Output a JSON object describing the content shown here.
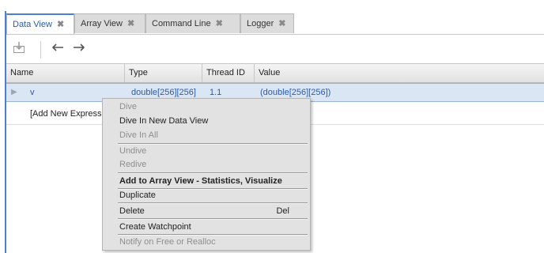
{
  "tabs": [
    {
      "label": "Data View",
      "active": true
    },
    {
      "label": "Array View",
      "active": false
    },
    {
      "label": "Command Line",
      "active": false
    },
    {
      "label": "Logger",
      "active": false
    }
  ],
  "tab_close_glyph": "✖",
  "toolbar": {
    "icons": [
      "dive-icon",
      "back-arrow-icon",
      "forward-arrow-icon"
    ]
  },
  "table": {
    "columns": [
      "Name",
      "Type",
      "Thread ID",
      "Value"
    ],
    "rows": [
      {
        "name": "v",
        "type": "double[256][256]",
        "thread": "1.1",
        "value": "(double[256][256])"
      }
    ],
    "add_new": "[Add New Expression]"
  },
  "context_menu": {
    "items": [
      {
        "label": "Dive",
        "disabled": true
      },
      {
        "label": "Dive In New Data View",
        "disabled": false
      },
      {
        "label": "Dive In All",
        "disabled": true
      },
      {
        "label": "Undive",
        "disabled": true
      },
      {
        "label": "Redive",
        "disabled": true
      },
      {
        "label": "Add to Array View - Statistics, Visualize",
        "disabled": false,
        "bold": true
      },
      {
        "label": "Duplicate",
        "disabled": false
      },
      {
        "label": "Delete",
        "disabled": false,
        "shortcut": "Del"
      },
      {
        "label": "Create Watchpoint",
        "disabled": false
      },
      {
        "label": "Notify on Free or Realloc",
        "disabled": true
      }
    ]
  },
  "colors": {
    "accent": "#4a7fd3",
    "selection": "#dbe6f4",
    "menu_bg": "#e2e2e2"
  }
}
